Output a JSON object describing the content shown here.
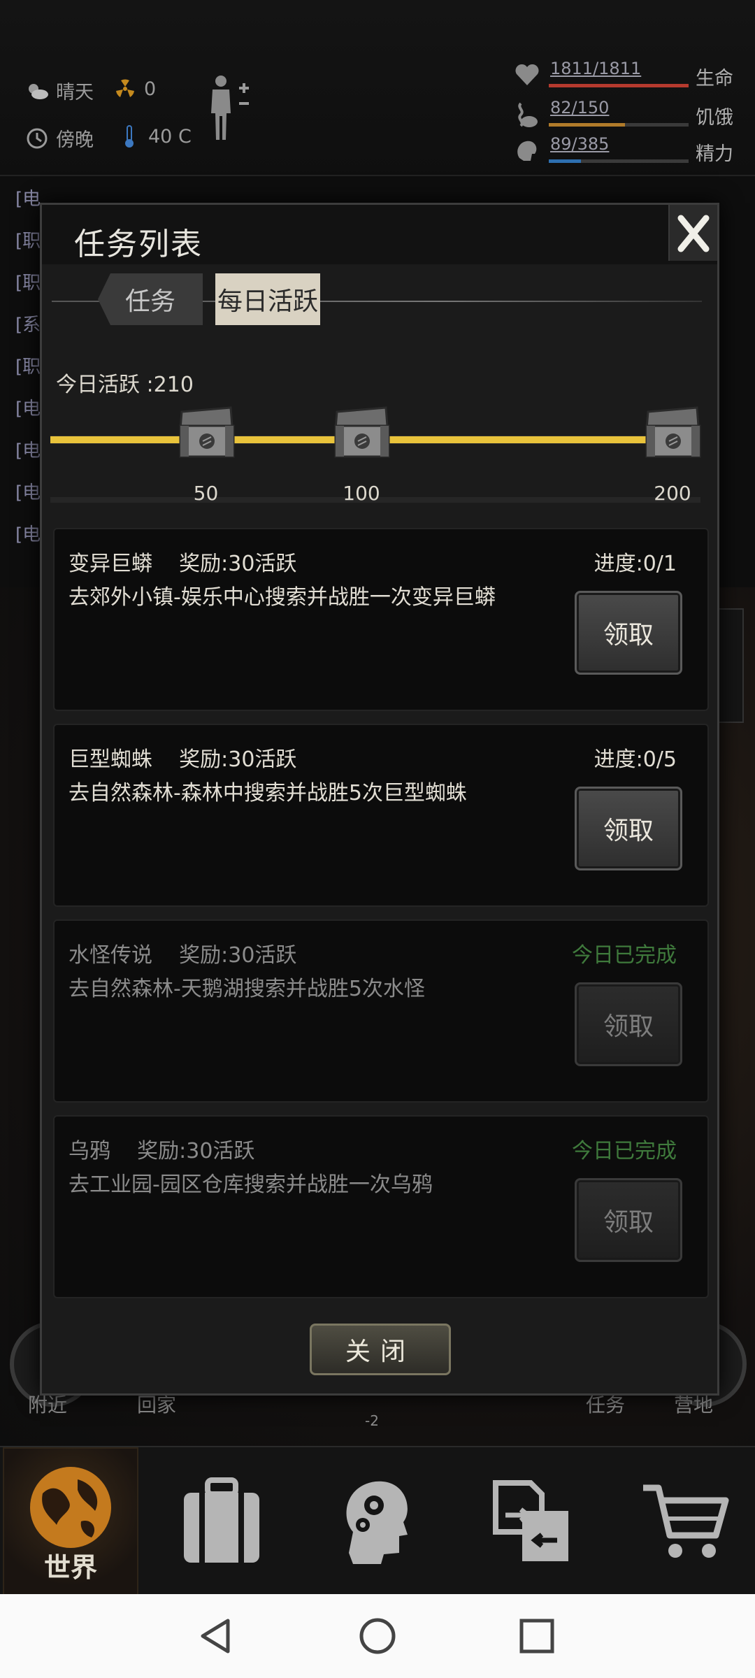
{
  "status": {
    "weather": "晴天",
    "radiation": "0",
    "time_of_day": "傍晚",
    "temperature": "40 C",
    "bars": [
      {
        "value_text": "1811/1811",
        "label": "生命",
        "fill": 1.0,
        "color": "#b53a2e"
      },
      {
        "value_text": "82/150",
        "label": "饥饿",
        "fill": 0.547,
        "color": "#b07b2a"
      },
      {
        "value_text": "89/385",
        "label": "精力",
        "fill": 0.231,
        "color": "#2e6fb0"
      }
    ]
  },
  "modal": {
    "title": "任务列表",
    "tabs": [
      {
        "label": "任务",
        "active": false
      },
      {
        "label": "每日活跃",
        "active": true
      }
    ],
    "activity_label": "今日活跃 :210",
    "activity_value": 210,
    "activity_max": 200,
    "milestones": [
      "50",
      "100",
      "200"
    ],
    "tasks": [
      {
        "name": "变异巨蟒",
        "reward": "奖励:30活跃",
        "desc": "去郊外小镇-娱乐中心搜索并战胜一次变异巨蟒",
        "progress": "进度:0/1",
        "button": "领取",
        "done": false
      },
      {
        "name": "巨型蜘蛛",
        "reward": "奖励:30活跃",
        "desc": "去自然森林-森林中搜索并战胜5次巨型蜘蛛",
        "progress": "进度:0/5",
        "button": "领取",
        "done": false
      },
      {
        "name": "水怪传说",
        "reward": "奖励:30活跃",
        "desc": "去自然森林-天鹅湖搜索并战胜5次水怪",
        "progress": "今日已完成",
        "button": "领取",
        "done": true
      },
      {
        "name": "乌鸦",
        "reward": "奖励:30活跃",
        "desc": "去工业园-园区仓库搜索并战胜一次乌鸦",
        "progress": "今日已完成",
        "button": "领取",
        "done": true
      }
    ],
    "close_label": "关闭"
  },
  "background": {
    "left_labels": [
      "附近",
      "回家"
    ],
    "right_labels": [
      "任务",
      "营地"
    ],
    "center_label": "-2"
  },
  "toolbar": {
    "items": [
      {
        "label": "世界",
        "icon": "globe-icon",
        "active": true
      },
      {
        "label": "",
        "icon": "backpack-icon",
        "active": false
      },
      {
        "label": "",
        "icon": "brain-skills-icon",
        "active": false
      },
      {
        "label": "",
        "icon": "exchange-icon",
        "active": false
      },
      {
        "label": "",
        "icon": "shopping-cart-icon",
        "active": false
      }
    ]
  },
  "navbar": {
    "icons": [
      "back-icon",
      "home-icon",
      "recents-icon"
    ]
  }
}
